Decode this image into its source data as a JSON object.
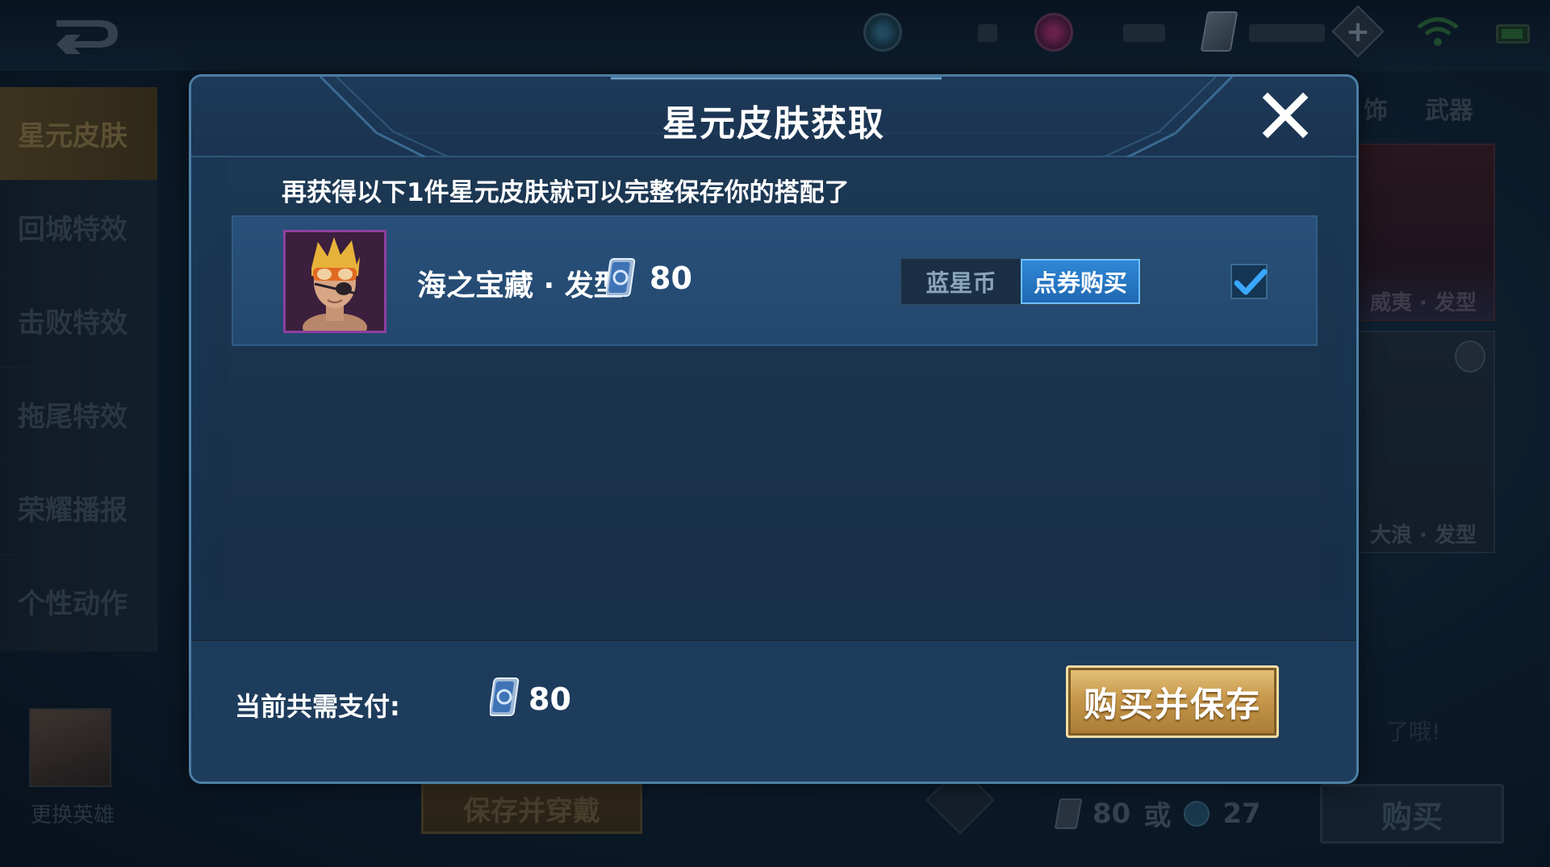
{
  "background": {
    "left_menu": [
      {
        "label": "星元皮肤",
        "active": true
      },
      {
        "label": "回城特效",
        "active": false
      },
      {
        "label": "击败特效",
        "active": false
      },
      {
        "label": "拖尾特效",
        "active": false
      },
      {
        "label": "荣耀播报",
        "active": false
      },
      {
        "label": "个性动作",
        "active": false
      }
    ],
    "change_hero_label": "更换英雄",
    "right_tabs": [
      "饰",
      "武器"
    ],
    "cards": [
      {
        "label": "威夷 · 发型"
      },
      {
        "label": "大浪 · 发型"
      }
    ],
    "right_hint": "了哦!",
    "save_wear_label": "保存并穿戴",
    "price_voucher": "80",
    "price_or": "或",
    "price_coin": "27",
    "buy_label": "购买"
  },
  "modal": {
    "title": "星元皮肤获取",
    "subtitle": "再获得以下1件星元皮肤就可以完整保存你的搭配了",
    "item": {
      "name": "海之宝藏 · 发型",
      "price": "80",
      "currency_options": [
        "蓝星币",
        "点券购买"
      ],
      "selected_currency": "点券购买",
      "checked": true
    },
    "footer": {
      "total_label": "当前共需支付:",
      "total_price": "80",
      "buy_save_label": "购买并保存"
    }
  },
  "colors": {
    "accent_blue": "#3088d6",
    "gold_button": "#c7984c",
    "modal_border": "#4c7fa4"
  }
}
